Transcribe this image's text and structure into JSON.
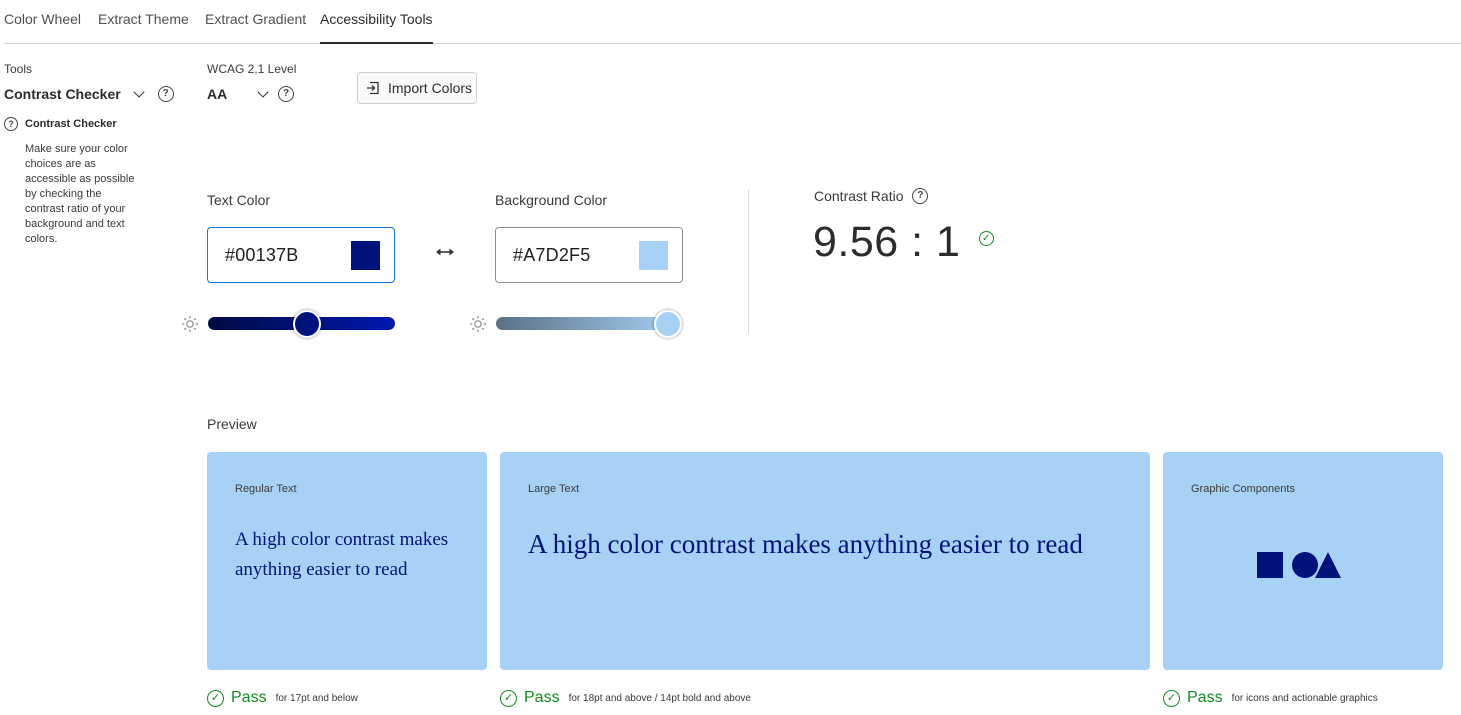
{
  "tabs": [
    {
      "label": "Color Wheel",
      "active": false
    },
    {
      "label": "Extract Theme",
      "active": false
    },
    {
      "label": "Extract Gradient",
      "active": false
    },
    {
      "label": "Accessibility Tools",
      "active": true
    }
  ],
  "sidebar": {
    "tools_label": "Tools",
    "selected_tool": "Contrast Checker",
    "info_title": "Contrast Checker",
    "info_text": "Make sure your color choices are as accessible as possible by checking the contrast ratio of your background and text colors."
  },
  "wcag": {
    "label": "WCAG 2.1 Level",
    "value": "AA"
  },
  "import_button": {
    "label": "Import Colors",
    "icon": "import-icon"
  },
  "text_color": {
    "label": "Text Color",
    "hex": "#00137B",
    "swatch": "#00137B",
    "brightness": 0.53,
    "track_from": "#000a42",
    "track_to": "#0018b0"
  },
  "background_color": {
    "label": "Background Color",
    "hex": "#A7D2F5",
    "swatch": "#A7D2F5",
    "brightness": 1.0,
    "track_from": "#5a7087",
    "track_to": "#a7d2f5"
  },
  "contrast": {
    "label": "Contrast Ratio",
    "value": "9.56 : 1",
    "status": "pass"
  },
  "preview": {
    "label": "Preview",
    "regular": {
      "title": "Regular Text",
      "sample": "A high color contrast makes anything easier to read",
      "result": "Pass",
      "criteria": "for 17pt and below"
    },
    "large": {
      "title": "Large Text",
      "sample": "A high color contrast makes anything easier to read",
      "result": "Pass",
      "criteria": "for 18pt and above / 14pt bold and above"
    },
    "graphic": {
      "title": "Graphic Components",
      "result": "Pass",
      "criteria": "for icons and actionable graphics"
    }
  },
  "colors": {
    "accent_border": "#1473e6",
    "pass_green": "#128a1e",
    "card_bg": "#A7D2F5",
    "text_fg": "#00137B"
  }
}
